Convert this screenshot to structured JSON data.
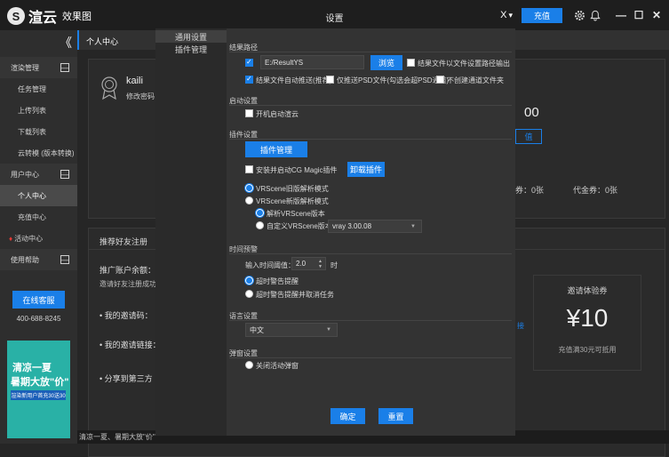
{
  "app": {
    "logo_glyph": "S",
    "name": "渲云",
    "subtitle": "效果图"
  },
  "topbar": {
    "topup_label": "充值",
    "close_x": "X",
    "dropdown": "▾"
  },
  "window": {
    "minimize": "—",
    "maximize": "☐",
    "close": "✕"
  },
  "sidebar": {
    "collapse": "《",
    "groups": [
      {
        "label": "渲染管理",
        "toggle": "—",
        "items": [
          "任务管理",
          "上传列表",
          "下载列表",
          "云转模 (版本转换)"
        ]
      },
      {
        "label": "用户中心",
        "toggle": "—",
        "items": [
          "个人中心",
          "充值中心",
          "活动中心"
        ]
      },
      {
        "label": "使用帮助",
        "toggle": "—",
        "items": []
      }
    ],
    "active_item": "个人中心",
    "service_button": "在线客服",
    "phone": "400-688-8245",
    "banner": {
      "line1": "清凉一夏",
      "line2": "暑期大放\"价\"",
      "line3": "渲染新用户首充30送30"
    }
  },
  "content": {
    "section_title": "个人中心",
    "user": {
      "name": "kaili",
      "change_password": "修改密码"
    },
    "balance_fragment": "00",
    "btn_fragment": "值",
    "coupon_fragment": "券：0张",
    "voucher": "代金券：0张",
    "invite": {
      "title": "推荐好友注册",
      "balance_label": "推广账户余额：",
      "desc": "邀请好友注册成功后",
      "code": "我的邀请码：",
      "link": "我的邀请链接：",
      "share": "分享到第三方"
    },
    "trial": {
      "title": "邀请体验券",
      "amount": "¥10",
      "note": "充值满30元可抵用"
    },
    "link_fragment": "接"
  },
  "bottom_text": "清凉一夏、暑期大放\"价\"",
  "dialog": {
    "title": "设置",
    "nav": [
      "通用设置",
      "插件管理"
    ],
    "output": {
      "section": "结果路径",
      "path_value": "E:/ResultYS",
      "browse": "浏览",
      "save_by_task": "结果文件以文件设置路径输出",
      "auto_download": "结果文件自动推送(推荐)",
      "only_psd": "仅推送PSD文件(勾选会超PSD通道)",
      "no_channel": "不创建通道文件夹"
    },
    "startup": {
      "section": "启动设置",
      "auto_start": "开机启动渲云"
    },
    "plugins": {
      "section": "插件设置",
      "manage": "插件管理",
      "install_cg": "安装并启动CG Magic插件",
      "uninstall": "卸载插件",
      "vr_old": "VRScene旧版解析模式",
      "vr_new": "VRScene新版解析模式",
      "parse_version": "解析VRScene版本",
      "custom_version": "自定义VRScene版本",
      "vray_version": "vray 3.00.08"
    },
    "timeout": {
      "section": "时间预警",
      "label": "输入时间阈值：",
      "value": "2.0",
      "unit": "时",
      "warn": "超时警告提醒",
      "warn_stop": "超时警告提醒并取消任务"
    },
    "language": {
      "section": "语言设置",
      "value": "中文"
    },
    "popup": {
      "section": "弹窗设置",
      "close_popup": "关闭活动弹窗"
    },
    "ok": "确定",
    "reset": "重置"
  }
}
